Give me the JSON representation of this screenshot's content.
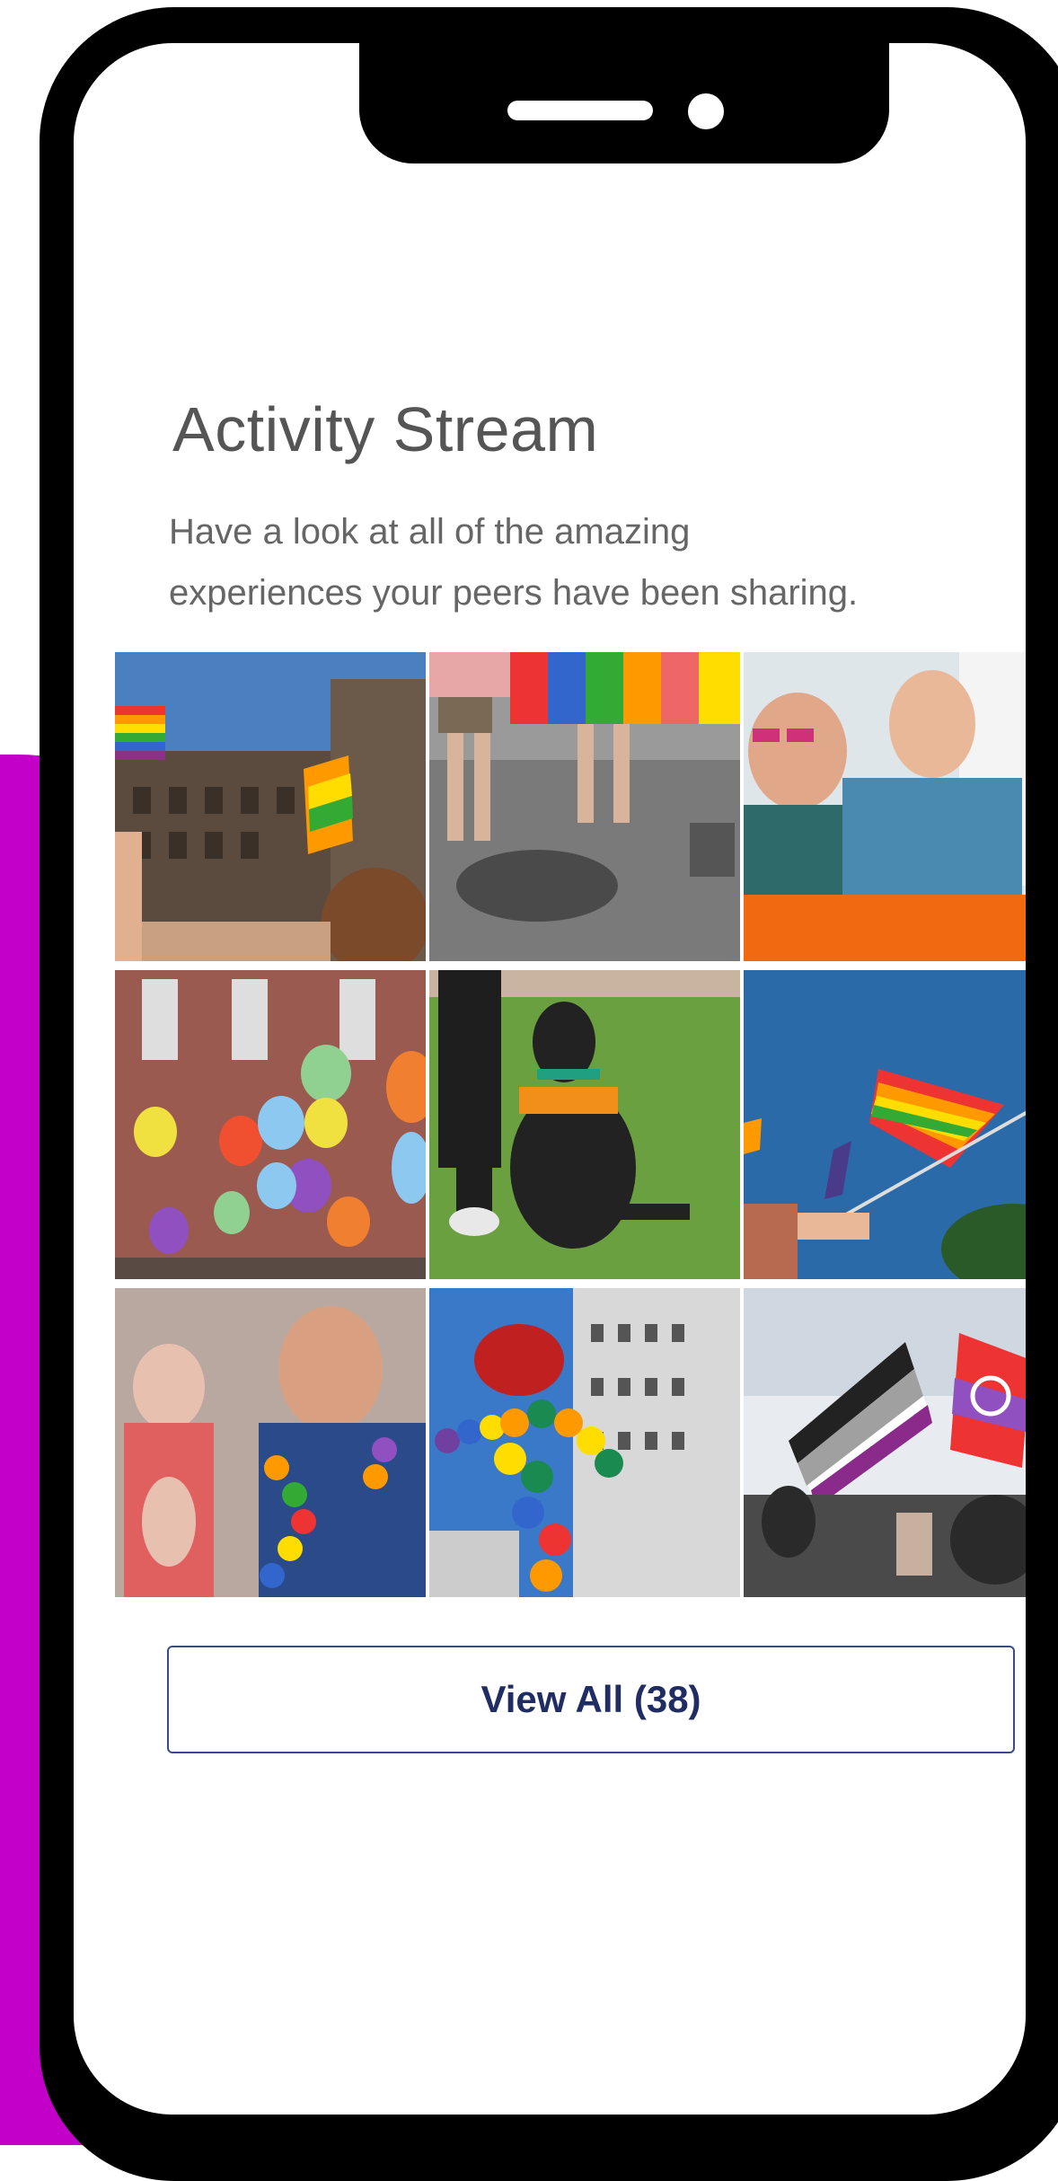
{
  "screen": {
    "title": "Activity Stream",
    "subtitle_line1": "Have a look at all of the amazing",
    "subtitle_line2": "experiences your peers have been sharing."
  },
  "gallery": {
    "photos": [
      {
        "name": "photo-building-rainbow-flags"
      },
      {
        "name": "photo-legs-rainbow-banner"
      },
      {
        "name": "photo-two-men-smiling"
      },
      {
        "name": "photo-balloons-brick-building"
      },
      {
        "name": "photo-dog-rainbow-bandana"
      },
      {
        "name": "photo-pride-flags-sky"
      },
      {
        "name": "photo-man-flower-lei"
      },
      {
        "name": "photo-balloon-arch-city"
      },
      {
        "name": "photo-asexual-pride-flags"
      }
    ]
  },
  "actions": {
    "view_all_label": "View All (38)"
  },
  "colors": {
    "accent_purple": "#c200c8",
    "button_border": "#3b4a8a",
    "button_text": "#1f2d63"
  }
}
